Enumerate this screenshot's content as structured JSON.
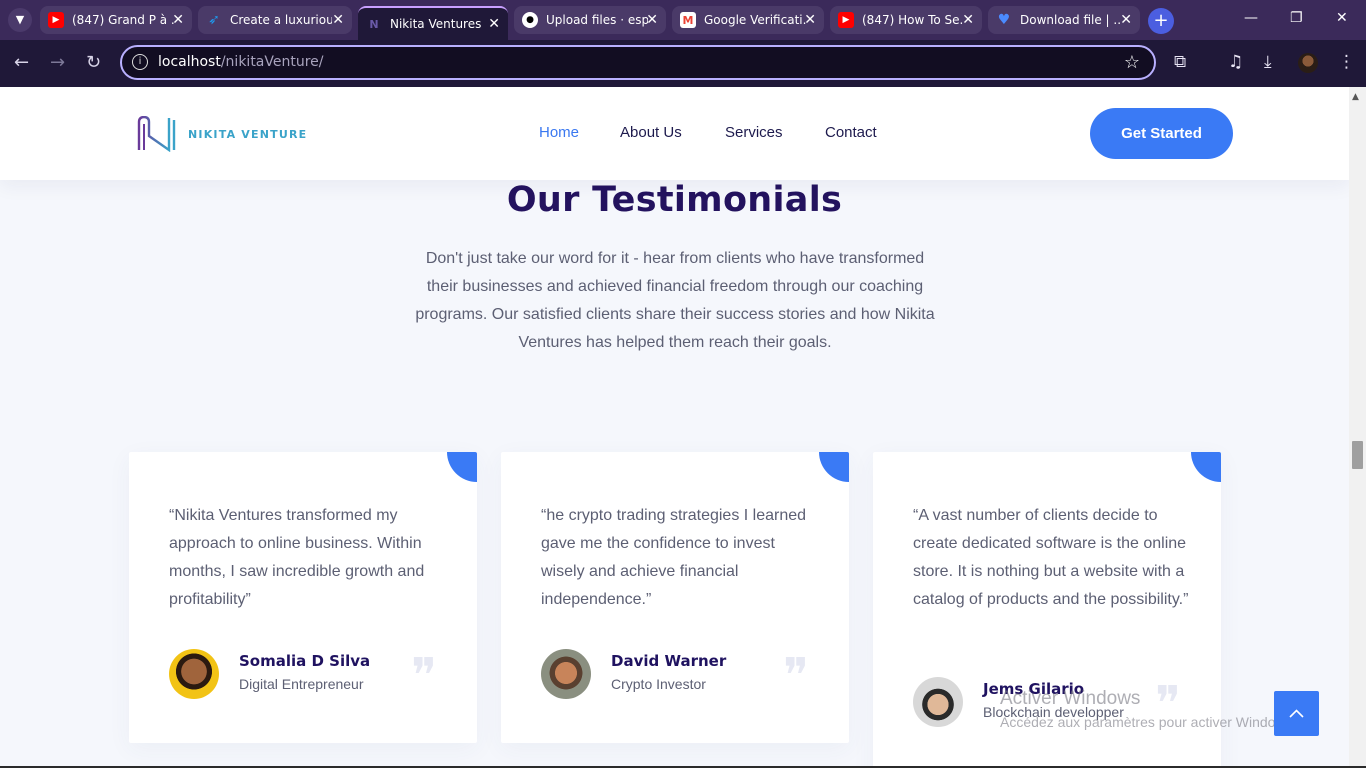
{
  "browser": {
    "tabs": [
      {
        "title": "(847) Grand P à ...",
        "favicon": "youtube-icon",
        "color": "#ff0000"
      },
      {
        "title": "Create a luxurious",
        "favicon": "bird-icon",
        "color": "#1d9bf0"
      },
      {
        "title": "Nikita Ventures",
        "favicon": "nikita-logo-icon",
        "color": "#24135f",
        "active": true
      },
      {
        "title": "Upload files · esp",
        "favicon": "github-icon",
        "color": "#ffffff"
      },
      {
        "title": "Google Verificati...",
        "favicon": "gmail-icon",
        "color": "#ea4335"
      },
      {
        "title": "(847) How To Se...",
        "favicon": "youtube-icon",
        "color": "#ff0000"
      },
      {
        "title": "Download file | ...",
        "favicon": "heart-icon",
        "color": "#4b8bff"
      }
    ],
    "address": {
      "host": "localhost",
      "path": "/nikitaVenture/"
    }
  },
  "site": {
    "logo_text": "NIKITA VENTURE",
    "nav": [
      {
        "label": "Home",
        "active": true
      },
      {
        "label": "About Us"
      },
      {
        "label": "Services"
      },
      {
        "label": "Contact"
      }
    ],
    "cta_label": "Get Started",
    "accent_color": "#3a7af5",
    "heading_color": "#24135f"
  },
  "testimonials": {
    "title": "Our Testimonials",
    "description": "Don't just take our word for it - hear from clients who have transformed their businesses and achieved financial freedom through our coaching programs. Our satisfied clients share their success stories and how Nikita Ventures has helped them reach their goals.",
    "items": [
      {
        "quote": "“Nikita Ventures transformed my approach to online business. Within months, I saw incredible growth and profitability”",
        "name": "Somalia D Silva",
        "role": "Digital Entrepreneur"
      },
      {
        "quote": "“he crypto trading strategies I learned gave me the confidence to invest wisely and achieve financial independence.”",
        "name": "David Warner",
        "role": "Crypto Investor"
      },
      {
        "quote": "“A vast number of clients decide to create dedicated software is the online store. It is nothing but a website with a catalog of products and the possibility.”",
        "name": "Jems Gilario",
        "role": "Blockchain developper"
      }
    ]
  },
  "windows_watermark": {
    "line1": "Activer Windows",
    "line2": "Accédez aux paramètres pour activer Windows."
  }
}
